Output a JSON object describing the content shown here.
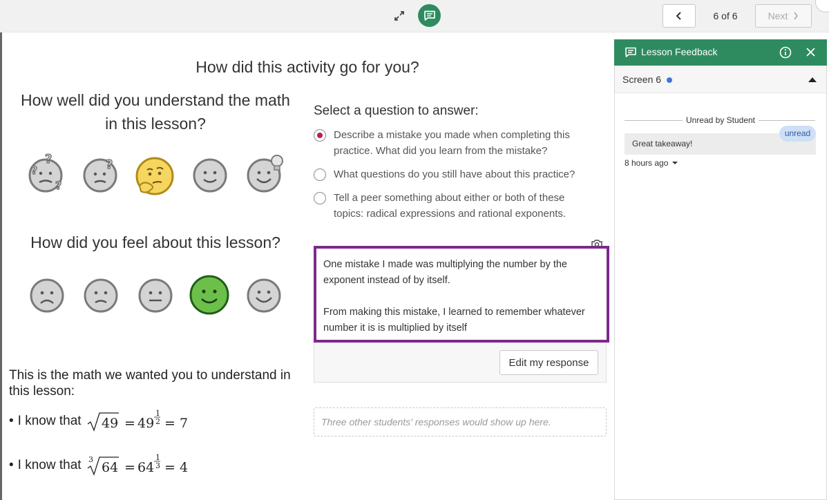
{
  "topbar": {
    "page_counter": "6 of 6",
    "next_label": "Next",
    "accent_color": "#2e8b60"
  },
  "activity": {
    "title": "How did this activity go for you?",
    "understand_question": "How well did you understand the math in this lesson?",
    "understand_scale": [
      "very-confused-face-icon",
      "confused-face-icon",
      "thinking-face-icon",
      "neutral-smile-face-icon",
      "idea-face-icon"
    ],
    "understand_selected_index": 2,
    "feel_question": "How did you feel about this lesson?",
    "feel_scale": [
      "frown-face-icon",
      "sad-face-icon",
      "neutral-face-icon",
      "smile-face-icon",
      "happy-face-icon"
    ],
    "feel_selected_index": 3
  },
  "math": {
    "intro": "This is the math we wanted you to understand in this lesson:",
    "line1_prefix": "I know that",
    "line2_prefix": "I  know that",
    "sqrt_49": "49",
    "pow_49": "49",
    "exp_half_num": "1",
    "exp_half_den": "2",
    "result_7": "= 7",
    "cbrt_index": "3",
    "cbrt_64": "64",
    "pow_64": "64",
    "exp_third_num": "1",
    "exp_third_den": "3",
    "result_4": "= 4",
    "equals": "="
  },
  "question_select": {
    "label": "Select a question to answer:",
    "options": [
      {
        "text": "Describe a mistake you made when completing this practice. What did you learn from the mistake?",
        "selected": true
      },
      {
        "text": "What questions do you still have about this practice?",
        "selected": false
      },
      {
        "text": "Tell a peer something about either or both of these topics: radical expressions and rational exponents.",
        "selected": false
      }
    ]
  },
  "response": {
    "paragraph1": "One mistake I made was multiplying the number by the exponent instead of by itself.",
    "paragraph2": "From making this mistake, I learned to remember whatever number it is is multiplied by itself",
    "edit_label": "Edit my response",
    "others_placeholder": "Three other students' responses would show up here.",
    "highlight_color": "#7b2a8c"
  },
  "feedback_panel": {
    "title": "Lesson Feedback",
    "screen_label": "Screen 6",
    "divider_label": "Unread by Student",
    "comment": "Great takeaway!",
    "badge": "unread",
    "timestamp": "8 hours ago",
    "dot_color": "#3f77d6"
  }
}
